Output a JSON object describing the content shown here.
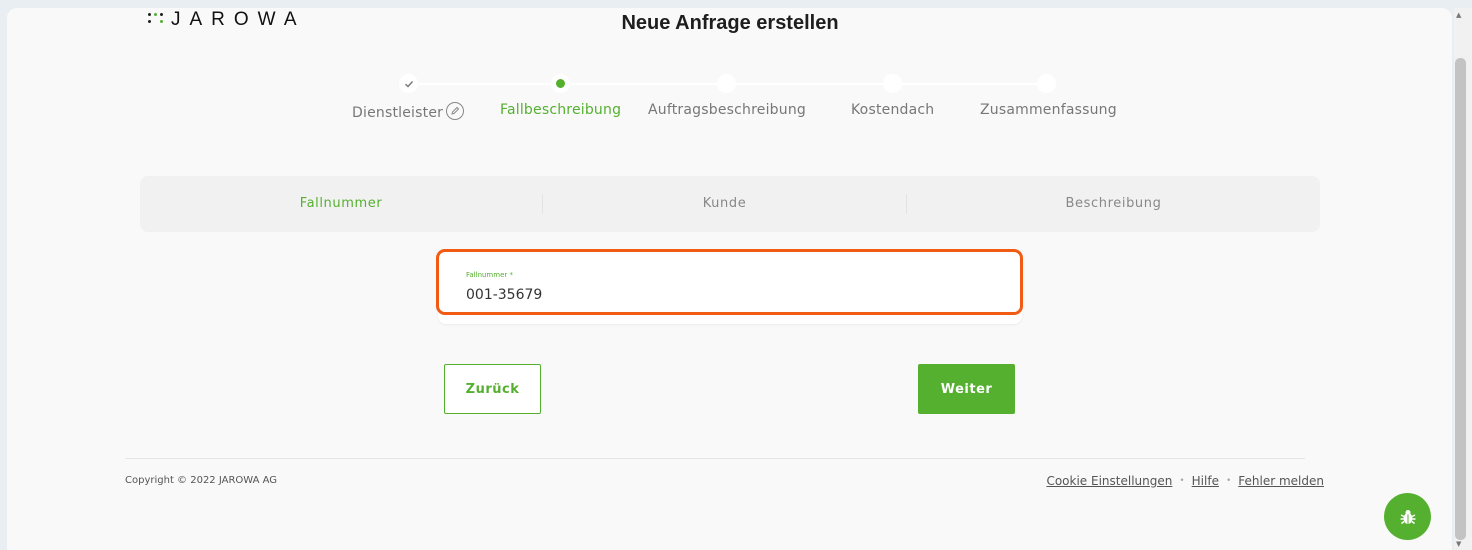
{
  "header": {
    "logo_text": "JAROWA",
    "page_title": "Neue Anfrage erstellen"
  },
  "stepper": {
    "steps": [
      {
        "label": "Dienstleister",
        "state": "done"
      },
      {
        "label": "Fallbeschreibung",
        "state": "active"
      },
      {
        "label": "Auftragsbeschreibung",
        "state": "pending"
      },
      {
        "label": "Kostendach",
        "state": "pending"
      },
      {
        "label": "Zusammenfassung",
        "state": "pending"
      }
    ]
  },
  "subtabs": [
    {
      "label": "Fallnummer",
      "active": true
    },
    {
      "label": "Kunde",
      "active": false
    },
    {
      "label": "Beschreibung",
      "active": false
    }
  ],
  "form": {
    "fallnummer_label": "Fallnummer *",
    "fallnummer_value": "001-35679"
  },
  "buttons": {
    "back_label": "Zurück",
    "next_label": "Weiter"
  },
  "footer": {
    "copyright": "Copyright © 2022 JAROWA AG",
    "links": [
      "Cookie Einstellungen",
      "Hilfe",
      "Fehler melden"
    ]
  },
  "colors": {
    "accent": "#55b030",
    "highlight": "#f25b14"
  },
  "icons": {
    "done_step": "check-icon",
    "edit": "pencil-icon",
    "fab": "bug-icon"
  }
}
